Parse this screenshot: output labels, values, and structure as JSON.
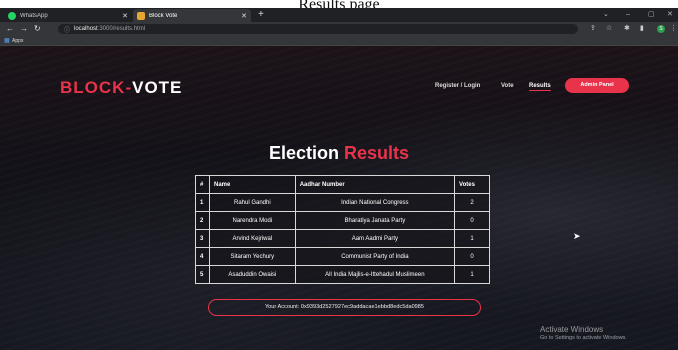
{
  "caption": "Results page",
  "browser": {
    "tabs": [
      {
        "label": "WhatsApp",
        "icon": "whatsapp-icon",
        "color": "#25d366"
      },
      {
        "label": "Block Vote",
        "icon": "block-vote-favicon",
        "color": "#e8a530"
      }
    ],
    "new_tab": "+",
    "window_controls": [
      "⌄",
      "–",
      "▢",
      "✕"
    ],
    "url_host": "localhost",
    "url_path": ":3000/results.html",
    "bookmarks": {
      "apps_label": "Apps"
    },
    "profile_initial": "S"
  },
  "site": {
    "logo_part1": "BLOCK-",
    "logo_part2": "VOTE",
    "nav": {
      "register": "Register / Login",
      "vote": "Vote",
      "results": "Results"
    },
    "admin_button": "Admin Panel",
    "heading_part1": "Election",
    "heading_part2": "Results",
    "table": {
      "headers": [
        "#",
        "Name",
        "Aadhar Number",
        "Votes"
      ],
      "rows": [
        {
          "num": "1",
          "name": "Rahul Gandhi",
          "party": "Indian National Congress",
          "votes": "2"
        },
        {
          "num": "2",
          "name": "Narendra Modi",
          "party": "Bharatiya Janata Party",
          "votes": "0"
        },
        {
          "num": "3",
          "name": "Arvind Kejriwal",
          "party": "Aam Aadmi Party",
          "votes": "1"
        },
        {
          "num": "4",
          "name": "Sitaram Yechury",
          "party": "Communist Party of India",
          "votes": "0"
        },
        {
          "num": "5",
          "name": "Asaduddin Owaisi",
          "party": "All India Majlis-e-Ittehadul Muslimeen",
          "votes": "1"
        }
      ]
    },
    "account": "Your Account: 0x9393d2527927ec9addacae1ebbd8edc5da0985"
  },
  "watermark": {
    "line1": "Activate Windows",
    "line2": "Go to Settings to activate Windows."
  },
  "colors": {
    "accent": "#e8334a",
    "chrome_bg": "#202124"
  }
}
